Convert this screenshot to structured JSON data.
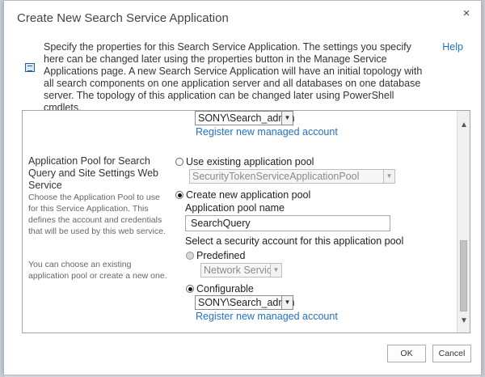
{
  "dialog": {
    "title": "Create New Search Service Application",
    "close_label": "×"
  },
  "description": {
    "text": "Specify the properties for this Search Service Application. The settings you specify here can be changed later using the properties button in the Manage Service Applications page. A new Search Service Application will have an initial topology with all search components on one application server and all databases on one database server. The topology of this application can be changed later using PowerShell cmdlets.",
    "help_link": "Help"
  },
  "top_account": {
    "value": "SONY\\Search_admin",
    "register_link": "Register new managed account"
  },
  "app_pool_section": {
    "title": "Application Pool for Search Query and Site Settings Web Service",
    "description_1": "Choose the Application Pool to use for this Service Application.  This defines the account and credentials that will be used by this web service.",
    "description_2": "You can choose an existing application pool or create a new one."
  },
  "use_existing": {
    "label": "Use existing application pool",
    "selected": false,
    "pool_value": "SecurityTokenServiceApplicationPool"
  },
  "create_new": {
    "label": "Create new application pool",
    "selected": true,
    "name_label": "Application pool name",
    "name_value": "SearchQuery",
    "security_label": "Select a security account for this application pool"
  },
  "predefined": {
    "label": "Predefined",
    "selected": false,
    "value": "Network Service"
  },
  "configurable": {
    "label": "Configurable",
    "selected": true,
    "value": "SONY\\Search_admin",
    "register_link": "Register new managed account"
  },
  "buttons": {
    "ok": "OK",
    "cancel": "Cancel"
  },
  "scrollbar": {
    "up_arrow": "▲",
    "down_arrow": "▼"
  },
  "colors": {
    "link": "#2372c2",
    "title_text": "#444444"
  }
}
